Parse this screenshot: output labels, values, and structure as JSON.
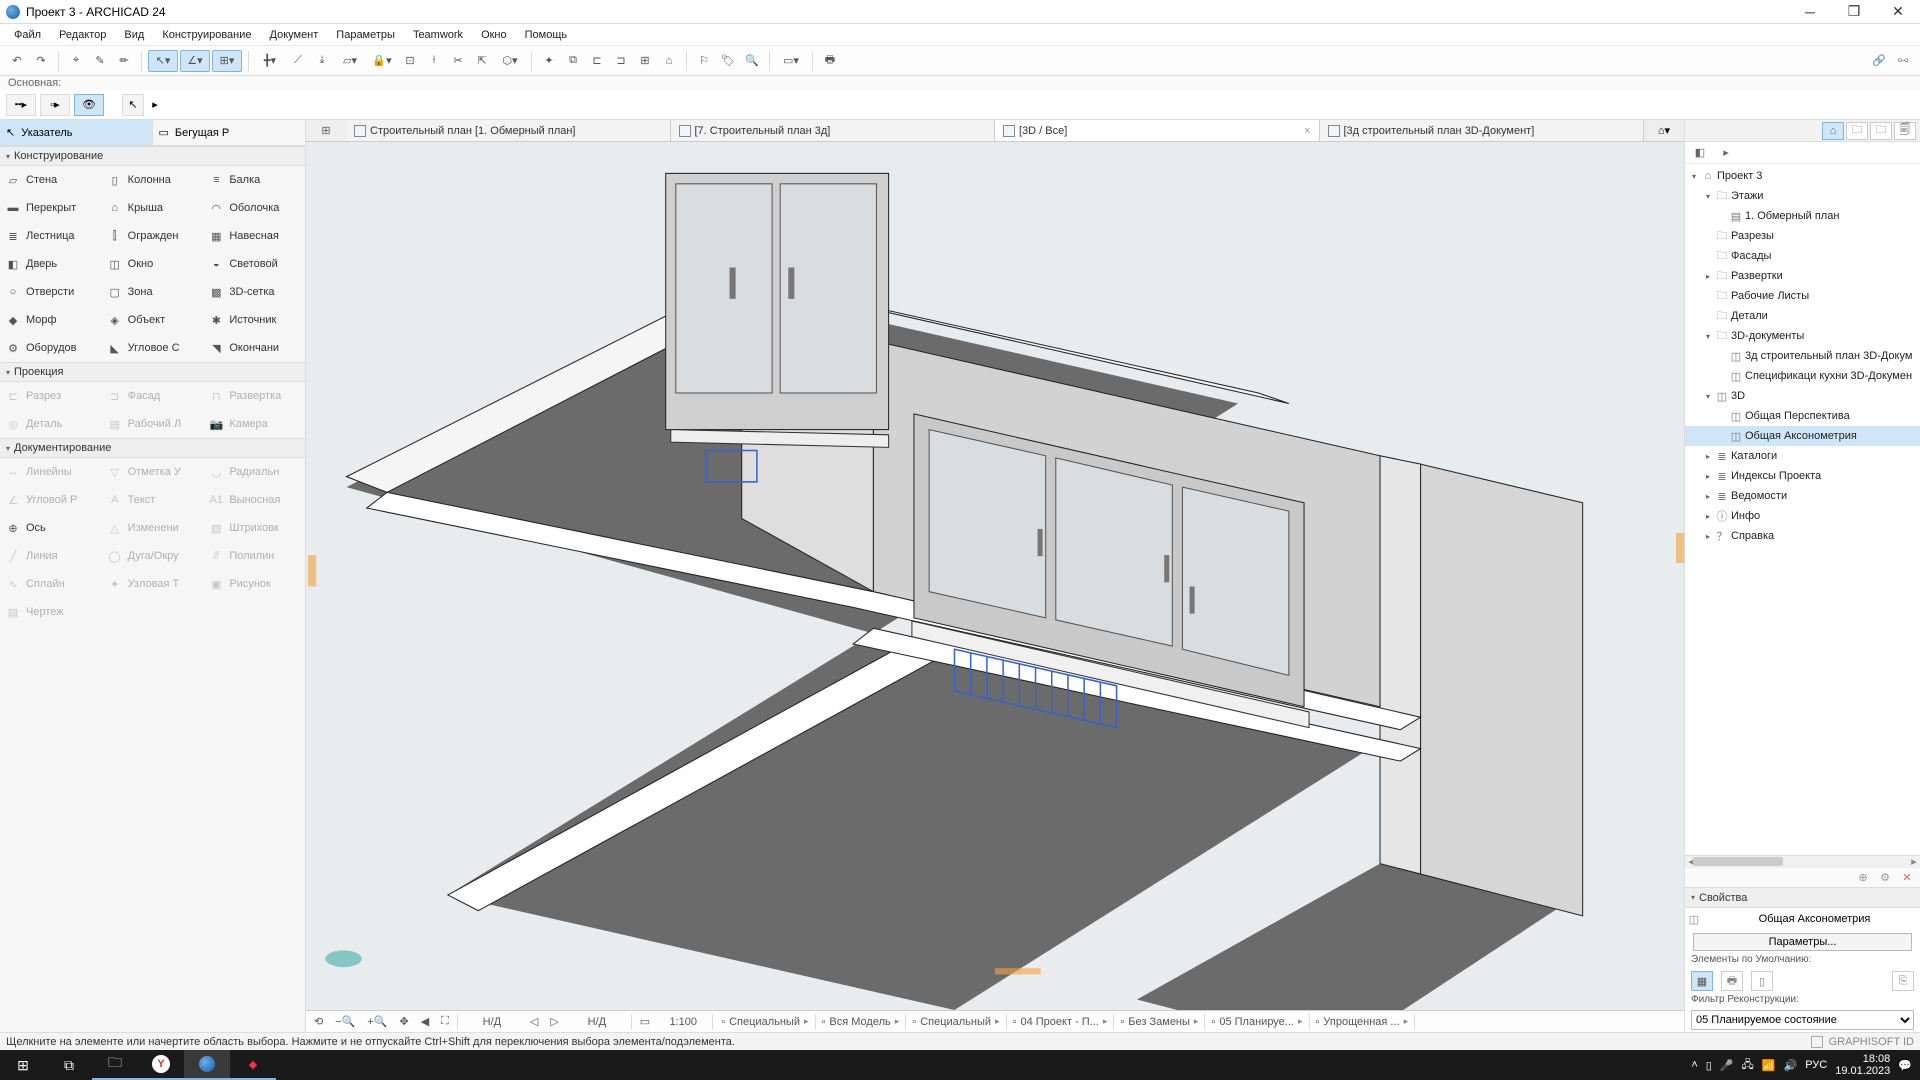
{
  "window": {
    "title": "Проект 3 - ARCHICAD 24"
  },
  "menu": [
    "Файл",
    "Редактор",
    "Вид",
    "Конструирование",
    "Документ",
    "Параметры",
    "Teamwork",
    "Окно",
    "Помощь"
  ],
  "subbar_label": "Основная:",
  "left": {
    "pointer": "Указатель",
    "marquee": "Бегущая Р",
    "section_design": "Конструирование",
    "tools_design": [
      [
        "Стена",
        "wall-icon"
      ],
      [
        "Колонна",
        "column-icon"
      ],
      [
        "Балка",
        "beam-icon"
      ],
      [
        "Перекрыт",
        "slab-icon"
      ],
      [
        "Крыша",
        "roof-icon"
      ],
      [
        "Оболочка",
        "shell-icon"
      ],
      [
        "Лестница",
        "stair-icon"
      ],
      [
        "Огражден",
        "railing-icon"
      ],
      [
        "Навесная",
        "curtain-icon"
      ],
      [
        "Дверь",
        "door-icon"
      ],
      [
        "Окно",
        "window-icon"
      ],
      [
        "Световой",
        "skylight-icon"
      ],
      [
        "Отверсти",
        "opening-icon"
      ],
      [
        "Зона",
        "zone-icon"
      ],
      [
        "3D-сетка",
        "mesh-icon"
      ],
      [
        "Морф",
        "morph-icon"
      ],
      [
        "Объект",
        "object-icon"
      ],
      [
        "Источник",
        "lamp-icon"
      ],
      [
        "Оборудов",
        "equipment-icon"
      ],
      [
        "Угловое С",
        "corner-icon"
      ],
      [
        "Окончани",
        "end-icon"
      ]
    ],
    "section_proj": "Проекция",
    "tools_proj": [
      [
        "Разрез",
        "section-icon"
      ],
      [
        "Фасад",
        "elevation-icon"
      ],
      [
        "Развертка",
        "interior-icon"
      ],
      [
        "Деталь",
        "detail-icon"
      ],
      [
        "Рабочий Л",
        "worksheet-icon"
      ],
      [
        "Камера",
        "camera-icon"
      ]
    ],
    "section_doc": "Документирование",
    "tools_doc": [
      [
        "Линейны",
        "lindim-icon"
      ],
      [
        "Отметка У",
        "level-icon"
      ],
      [
        "Радиальн",
        "raddim-icon"
      ],
      [
        "Угловой Р",
        "angdim-icon"
      ],
      [
        "Текст",
        "text-icon"
      ],
      [
        "Выносная",
        "label-icon"
      ],
      [
        "Ось",
        "grid-icon"
      ],
      [
        "Изменени",
        "change-icon"
      ],
      [
        "Штриховк",
        "fill-icon"
      ],
      [
        "Линия",
        "line-icon"
      ],
      [
        "Дуга/Окру",
        "arc-icon"
      ],
      [
        "Полилин",
        "polyline-icon"
      ],
      [
        "Сплайн",
        "spline-icon"
      ],
      [
        "Узловая Т",
        "hotspot-icon"
      ],
      [
        "Рисунок",
        "figure-icon"
      ],
      [
        "Чертеж",
        "drawing-icon"
      ],
      [
        "",
        ""
      ],
      [
        "",
        ""
      ]
    ]
  },
  "tabs": [
    {
      "label": "Строительный план [1. Обмерный план]",
      "active": false
    },
    {
      "label": "[7. Строительный план 3д]",
      "active": false
    },
    {
      "label": "[3D / Все]",
      "active": true,
      "closable": true
    },
    {
      "label": "[3д строительный план 3D-Документ]",
      "active": false
    }
  ],
  "bottom_status": {
    "nd1": "Н/Д",
    "nd2": "Н/Д",
    "scale": "1:100",
    "items": [
      {
        "label": "Специальный",
        "icon": "pen-icon"
      },
      {
        "label": "Вся Модель",
        "icon": "layers-icon"
      },
      {
        "label": "Специальный",
        "icon": "partial-icon"
      },
      {
        "label": "04 Проект - П...",
        "icon": "combo-icon"
      },
      {
        "label": "Без Замены",
        "icon": "override-icon"
      },
      {
        "label": "05 Планируе...",
        "icon": "reno-icon"
      },
      {
        "label": "Упрощенная ...",
        "icon": "3dstyle-icon"
      }
    ]
  },
  "nav": {
    "root": "Проект 3",
    "nodes": [
      {
        "d": 0,
        "exp": "▾",
        "icon": "home-icon",
        "label": "Проект 3"
      },
      {
        "d": 1,
        "exp": "▾",
        "icon": "folder-icon",
        "label": "Этажи"
      },
      {
        "d": 2,
        "exp": "",
        "icon": "plan-icon",
        "label": "1. Обмерный план"
      },
      {
        "d": 1,
        "exp": "",
        "icon": "folder-icon",
        "label": "Разрезы"
      },
      {
        "d": 1,
        "exp": "",
        "icon": "folder-icon",
        "label": "Фасады"
      },
      {
        "d": 1,
        "exp": "▸",
        "icon": "folder-icon",
        "label": "Развертки"
      },
      {
        "d": 1,
        "exp": "",
        "icon": "folder-icon",
        "label": "Рабочие Листы"
      },
      {
        "d": 1,
        "exp": "",
        "icon": "folder-icon",
        "label": "Детали"
      },
      {
        "d": 1,
        "exp": "▾",
        "icon": "folder-icon",
        "label": "3D-документы"
      },
      {
        "d": 2,
        "exp": "",
        "icon": "doc3d-icon",
        "label": "3д строительный план 3D-Докум"
      },
      {
        "d": 2,
        "exp": "",
        "icon": "doc3d-icon",
        "label": "Спецификаци кухни 3D-Докумен"
      },
      {
        "d": 1,
        "exp": "▾",
        "icon": "cube-icon",
        "label": "3D"
      },
      {
        "d": 2,
        "exp": "",
        "icon": "cube-icon",
        "label": "Общая Перспектива"
      },
      {
        "d": 2,
        "exp": "",
        "icon": "cube-icon",
        "label": "Общая Аксонометрия",
        "sel": true
      },
      {
        "d": 1,
        "exp": "▸",
        "icon": "list-icon",
        "label": "Каталоги"
      },
      {
        "d": 1,
        "exp": "▸",
        "icon": "list-icon",
        "label": "Индексы Проекта"
      },
      {
        "d": 1,
        "exp": "▸",
        "icon": "list-icon",
        "label": "Ведомости"
      },
      {
        "d": 1,
        "exp": "▸",
        "icon": "info-icon",
        "label": "Инфо"
      },
      {
        "d": 1,
        "exp": "▸",
        "icon": "help-icon",
        "label": "Справка"
      }
    ]
  },
  "props": {
    "header": "Свойства",
    "viewname": "Общая Аксонометрия",
    "params_btn": "Параметры...",
    "default_label": "Элементы по Умолчанию:",
    "filter_label": "Фильтр Реконструкции:",
    "filter_value": "05 Планируемое состояние"
  },
  "app_status": "Щелкните на элементе или начертите область выбора. Нажмите и не отпускайте Ctrl+Shift для переключения выбора элемента/подэлемента.",
  "brand": "GRAPHISOFT ID",
  "tray": {
    "lang": "РУС",
    "time": "18:08",
    "date": "19.01.2023"
  }
}
